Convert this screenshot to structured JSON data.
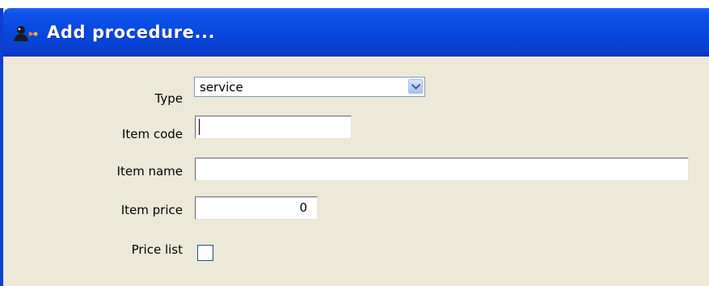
{
  "window": {
    "title": "Add procedure...",
    "icon": "add-procedure-icon"
  },
  "form": {
    "type": {
      "label": "Type",
      "value": "service"
    },
    "item_code": {
      "label": "Item code",
      "value": ""
    },
    "item_name": {
      "label": "Item name",
      "value": ""
    },
    "item_price": {
      "label": "Item price",
      "value": "0"
    },
    "price_list": {
      "label": "Price list",
      "checked": false
    }
  },
  "colors": {
    "titlebar": "#0747dd",
    "window_bg": "#ece9d8",
    "field_border": "#7f9db9"
  }
}
